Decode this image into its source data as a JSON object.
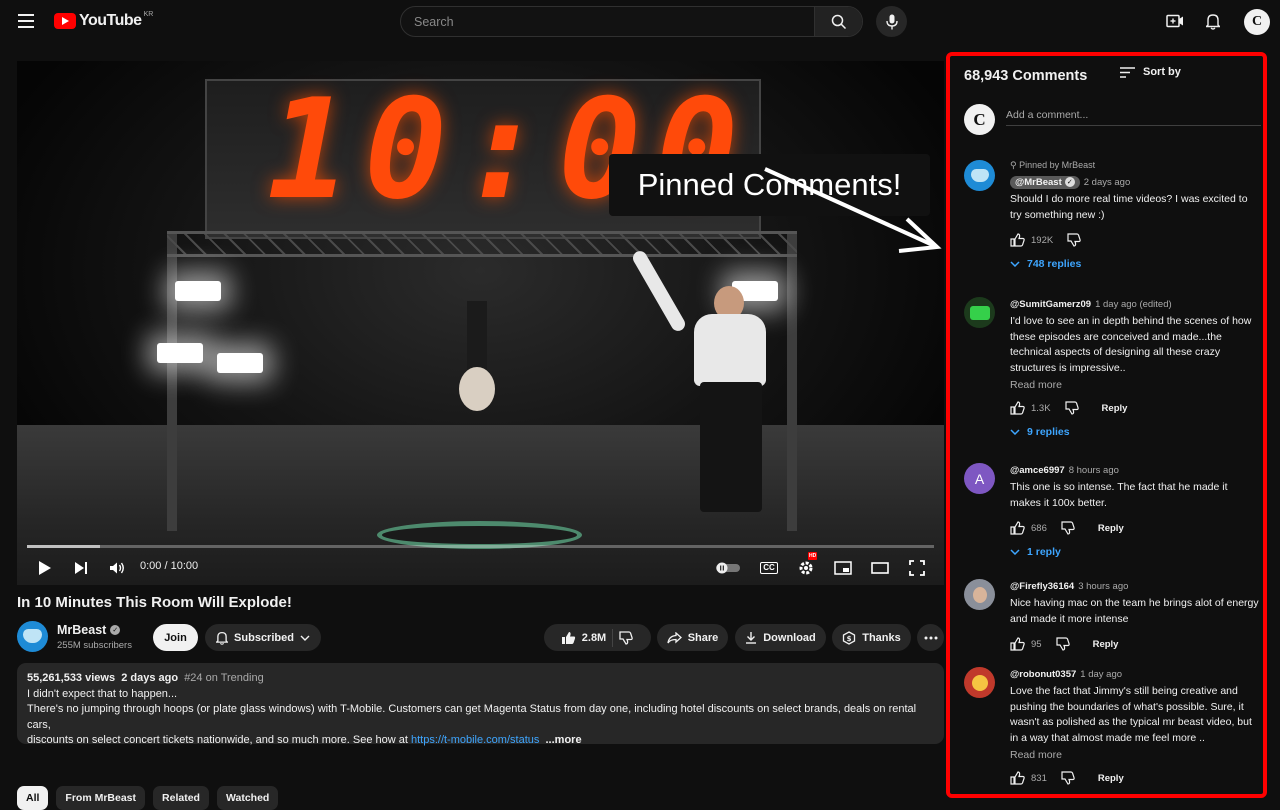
{
  "header": {
    "logo_text": "YouTube",
    "country": "KR",
    "search_placeholder": "Search",
    "user_initial": "C"
  },
  "player": {
    "timer": "10:00",
    "overlay_text": "Pinned Comments!",
    "current_time": "0:00 / 10:00",
    "progress": 0.08,
    "cc_label": "CC",
    "hd_label": "HD"
  },
  "video": {
    "title": "In 10 Minutes This Room Will Explode!",
    "channel": "MrBeast",
    "subscribers": "255M subscribers",
    "join_label": "Join",
    "subscribed_label": "Subscribed",
    "likes": "2.8M",
    "share_label": "Share",
    "download_label": "Download",
    "thanks_label": "Thanks"
  },
  "description": {
    "views": "55,261,533 views",
    "date": "2 days ago",
    "trending": "#24 on Trending",
    "line1": "I didn't expect that to happen...",
    "line2": "There's no jumping through hoops (or plate glass windows) with T-Mobile. Customers can get Magenta Status from day one, including hotel discounts on select brands, deals on rental cars,",
    "line3": "discounts on select concert tickets nationwide, and so much more. See how at ",
    "link": "https://t-mobile.com/status",
    "more": "...more"
  },
  "chips": [
    "All",
    "From MrBeast",
    "Related",
    "Watched"
  ],
  "comments_panel": {
    "count_label": "68,943 Comments",
    "sort_label": "Sort by",
    "add_placeholder": "Add a comment...",
    "reply_label": "Reply",
    "read_more": "Read more",
    "pinned_by": "Pinned by MrBeast",
    "items": [
      {
        "author": "@MrBeast",
        "time": "2 days ago",
        "text": "Should I do more real time videos? I was excited to try something new :)",
        "likes": "192K",
        "replies": "748 replies",
        "avatar_color": "#1e8bd6"
      },
      {
        "author": "@SumitGamerz09",
        "time": "1 day ago (edited)",
        "text": "I'd love to see an in depth behind the scenes of how these episodes are conceived and made...the technical aspects of designing all these crazy structures is impressive..",
        "likes": "1.3K",
        "replies": "9 replies",
        "avatar_color": "#1c3a1c"
      },
      {
        "author": "@amce6997",
        "time": "8 hours ago",
        "initial": "A",
        "text": "This one is so intense. The fact that he made it makes it 100x better.",
        "likes": "686",
        "replies": "1 reply",
        "avatar_color": "#7e57c2"
      },
      {
        "author": "@Firefly36164",
        "time": "3 hours ago",
        "text": "Nice having mac on the team he brings alot of energy and made it more intense",
        "likes": "95",
        "avatar_color": "#8a8f9a"
      },
      {
        "author": "@robonut0357",
        "time": "1 day ago",
        "text": "Love the fact that Jimmy's still being creative and pushing the boundaries of what's possible. Sure, it wasn't as polished as the typical mr beast video, but in a way that almost made me feel more ..",
        "likes": "831",
        "avatar_color": "#c0392b"
      }
    ]
  }
}
